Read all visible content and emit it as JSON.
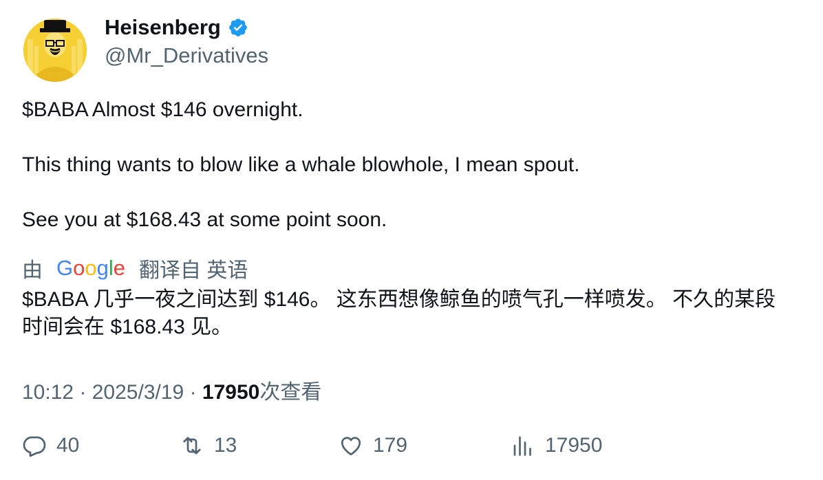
{
  "author": {
    "name": "Heisenberg",
    "handle": "@Mr_Derivatives",
    "verified": true,
    "avatar_icon": "heisenberg-avatar-icon",
    "verified_color": "#1d9bf0"
  },
  "tweet": {
    "lines": [
      "$BABA Almost $146 overnight.",
      "This thing wants to blow like a whale blowhole, I mean spout.",
      "See you at $168.43 at some point soon."
    ]
  },
  "translation": {
    "prefix": "由",
    "provider_letters": [
      "G",
      "o",
      "o",
      "g",
      "l",
      "e"
    ],
    "suffix": "翻译自 英语",
    "text": "$BABA 几乎一夜之间达到 $146。 这东西想像鲸鱼的喷气孔一样喷发。 不久的某段时间会在 $168.43 见。"
  },
  "meta": {
    "time": "10:12",
    "separator": "·",
    "date": "2025/3/19",
    "views": "17950",
    "views_label": "次查看"
  },
  "actions": {
    "replies": "40",
    "reposts": "13",
    "likes": "179",
    "views": "17950"
  },
  "colors": {
    "text": "#0f1419",
    "secondary": "#536471",
    "accent": "#1d9bf0"
  }
}
